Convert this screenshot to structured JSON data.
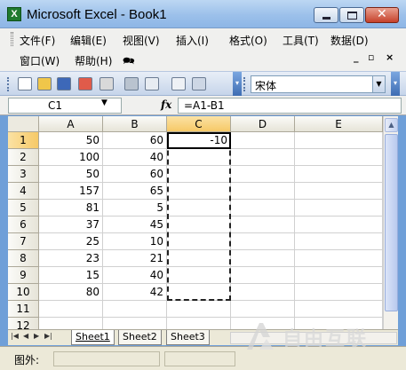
{
  "window": {
    "title": "Microsoft Excel - Book1",
    "close_symbol": "✕"
  },
  "menu": {
    "row1": [
      "文件(F)",
      "编辑(E)",
      "视图(V)",
      "插入(I)",
      "格式(O)",
      "工具(T)",
      "数据(D)"
    ],
    "row2": [
      "窗口(W)",
      "帮助(H)"
    ]
  },
  "toolbar": {
    "font_name": "宋体",
    "icons": [
      "new-icon",
      "open-icon",
      "save-icon",
      "permission-icon",
      "email-icon",
      "print-icon",
      "print-preview-icon",
      "spelling-icon",
      "research-icon"
    ]
  },
  "formula_bar": {
    "name_box": "C1",
    "fx": "fx",
    "formula": "=A1-B1"
  },
  "sheet": {
    "columns": [
      "A",
      "B",
      "C",
      "D",
      "E"
    ],
    "rows": [
      "1",
      "2",
      "3",
      "4",
      "5",
      "6",
      "7",
      "8",
      "9",
      "10",
      "11",
      "12"
    ],
    "selected_cell": "C1",
    "data": [
      [
        "50",
        "60",
        "-10"
      ],
      [
        "100",
        "40",
        ""
      ],
      [
        "50",
        "60",
        ""
      ],
      [
        "157",
        "65",
        ""
      ],
      [
        "81",
        "5",
        ""
      ],
      [
        "37",
        "45",
        ""
      ],
      [
        "25",
        "10",
        ""
      ],
      [
        "23",
        "21",
        ""
      ],
      [
        "15",
        "40",
        ""
      ],
      [
        "80",
        "42",
        ""
      ],
      [
        "",
        "",
        ""
      ],
      [
        "",
        "",
        ""
      ]
    ]
  },
  "tabs": [
    "Sheet1",
    "Sheet2",
    "Sheet3"
  ],
  "active_tab": "Sheet1",
  "status": {
    "text": "图外:"
  },
  "watermark": {
    "text": "自由互联"
  },
  "colors": {
    "title_bar": "#9cc0ea",
    "selected_header": "#f6c967",
    "grid_line": "#d0d0d0"
  }
}
